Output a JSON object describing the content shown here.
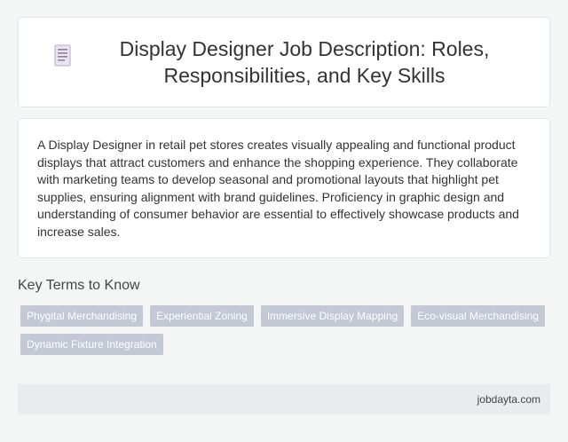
{
  "header": {
    "icon": "document-icon",
    "title": "Display Designer Job Description: Roles, Responsibilities, and Key Skills"
  },
  "description": {
    "text": "A Display Designer in retail pet stores creates visually appealing and functional product displays that attract customers and enhance the shopping experience. They collaborate with marketing teams to develop seasonal and promotional layouts that highlight pet supplies, ensuring alignment with brand guidelines. Proficiency in graphic design and understanding of consumer behavior are essential to effectively showcase products and increase sales."
  },
  "key_terms": {
    "heading": "Key Terms to Know",
    "tags": [
      "Phygital Merchandising",
      "Experiential Zoning",
      "Immersive Display Mapping",
      "Eco-visual Merchandising",
      "Dynamic Fixture Integration"
    ]
  },
  "footer": {
    "site": "jobdayta.com"
  },
  "colors": {
    "background": "#f4f6f6",
    "card": "#ffffff",
    "tag": "#c2c8d4",
    "footer": "#e8ecec"
  }
}
